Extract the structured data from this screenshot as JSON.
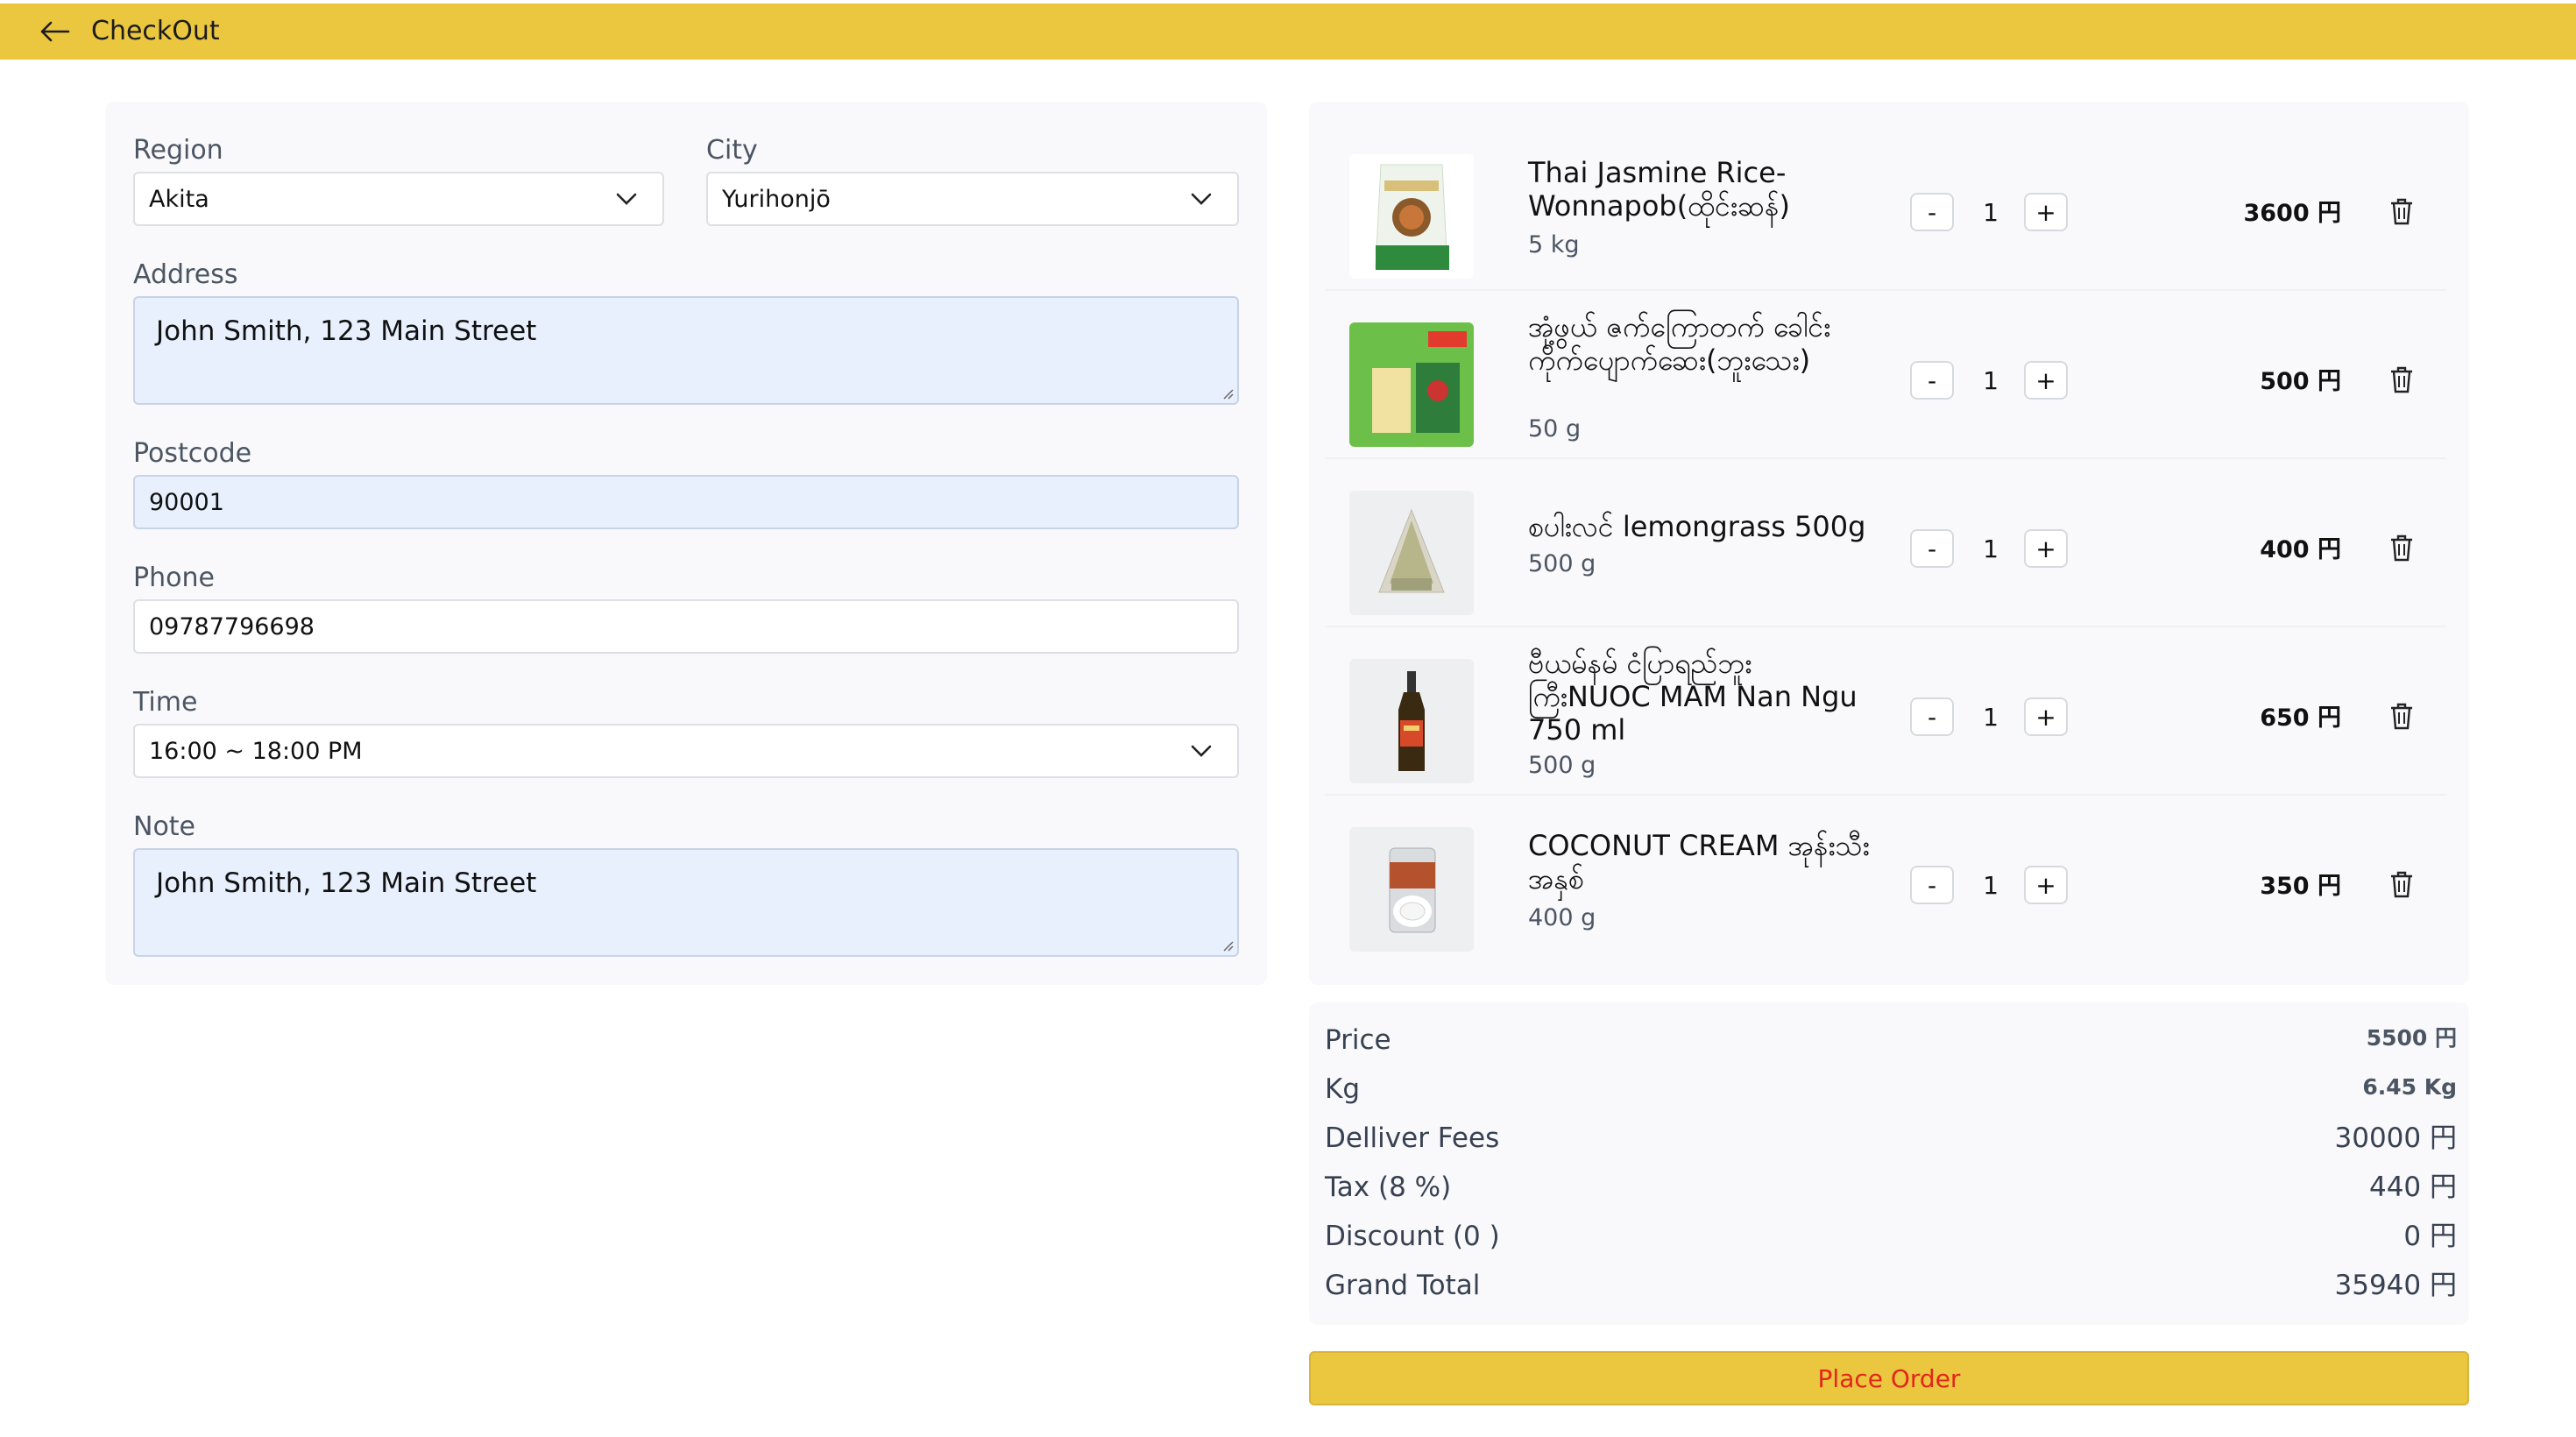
{
  "header": {
    "title": "CheckOut"
  },
  "form": {
    "region_label": "Region",
    "region_value": "Akita",
    "city_label": "City",
    "city_value": "Yurihonjō",
    "address_label": "Address",
    "address_value": "John Smith, 123 Main Street",
    "postcode_label": "Postcode",
    "postcode_value": "90001",
    "phone_label": "Phone",
    "phone_value": "09787796698",
    "time_label": "Time",
    "time_value": "16:00 ~ 18:00 PM",
    "note_label": "Note",
    "note_value": "John Smith, 123 Main Street"
  },
  "cart": {
    "items": [
      {
        "name": "Thai Jasmine Rice-Wonnapob(ထိုင်းဆန်)",
        "weight": "5 kg",
        "qty": "1",
        "price": "3600 円",
        "minus": "-",
        "plus": "+"
      },
      {
        "name": "အုံ့ဖွယ် ဇက်ကြောတက် ခေါင်းကိုက်ပျောက်ဆေး(ဘူးသေး)",
        "weight": "50 g",
        "qty": "1",
        "price": "500 円",
        "minus": "-",
        "plus": "+"
      },
      {
        "name": "စပါးလင် lemongrass 500g",
        "weight": "500 g",
        "qty": "1",
        "price": "400 円",
        "minus": "-",
        "plus": "+"
      },
      {
        "name": "ဗီယမ်နမ် ငံပြာရည်ဘူး ကြီးNUOC MAM Nan Ngu 750 ml",
        "weight": "500 g",
        "qty": "1",
        "price": "650 円",
        "minus": "-",
        "plus": "+"
      },
      {
        "name": "COCONUT CREAM အုန်းသီးအနှစ်",
        "weight": "400 g",
        "qty": "1",
        "price": "350 円",
        "minus": "-",
        "plus": "+"
      }
    ]
  },
  "summary": {
    "price_label": "Price",
    "price_value": "5500 円",
    "kg_label": "Kg",
    "kg_value": "6.45 Kg",
    "fees_label": "Delliver Fees",
    "fees_value": "30000 円",
    "tax_label": "Tax (8 %)",
    "tax_value": "440 円",
    "discount_label": "Discount (0 )",
    "discount_value": "0 円",
    "total_label": "Grand Total",
    "total_value": "35940 円"
  },
  "actions": {
    "place_order": "Place Order"
  },
  "colors": {
    "brand_yellow": "#ebc63f",
    "button_text": "#e3261c",
    "input_autofill": "#e8f0fe"
  }
}
